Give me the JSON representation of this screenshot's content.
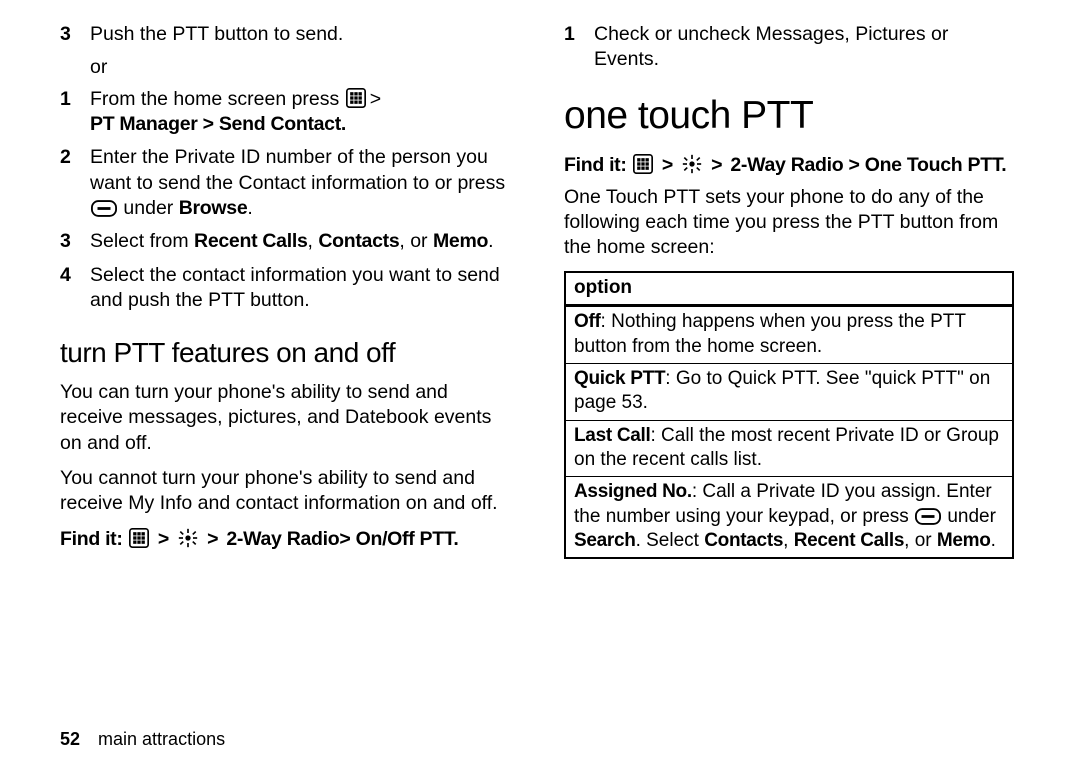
{
  "left": {
    "items": [
      {
        "n": "3",
        "text_a": "Push the PTT button to send."
      },
      {
        "or": "or"
      },
      {
        "n": "1",
        "text_a": "From the home screen press ",
        "after_icon": "",
        "path": "PT Manager > Send Contact."
      },
      {
        "n": "2",
        "text_a": "Enter the Private ID number of the person you want to send the Contact information to or press ",
        "after_soft": " under ",
        "browse": "Browse",
        "tail": "."
      },
      {
        "n": "3",
        "text_a": "Select from ",
        "b1": "Recent Calls",
        "sep1": ", ",
        "b2": "Contacts",
        "sep2": ", or ",
        "b3": "Memo",
        "tail": "."
      },
      {
        "n": "4",
        "text_a": "Select the contact information you want to send and push the PTT button."
      }
    ],
    "subhead": "turn PTT features on and off",
    "p1": "You can turn your phone's ability to send and receive messages, pictures, and Datebook events on and off.",
    "p2": "You cannot turn your phone's ability to send and receive My Info and contact information on and off.",
    "findit_label": "Find it:",
    "findit_path": " 2-Way Radio> On/Off PTT."
  },
  "right": {
    "item1": {
      "n": "1",
      "text": "Check or uncheck Messages, Pictures or Events."
    },
    "headline": "one touch PTT",
    "findit_label": "Find it:",
    "findit_path": " 2-Way Radio > One Touch PTT.",
    "intro": "One Touch PTT sets your phone to do any of the following each time you press the PTT button from the home screen:",
    "table": {
      "header": "option",
      "rows": [
        {
          "b": "Off",
          "text": ": Nothing happens when you press the PTT button from the home screen."
        },
        {
          "b": "Quick PTT",
          "text": ": Go to Quick PTT. See \"quick PTT\" on page 53."
        },
        {
          "b": "Last Call",
          "text": ": Call the most recent Private ID or Group on the recent calls list."
        },
        {
          "b": "Assigned No.",
          "text_a": ": Call a Private ID you assign. Enter the number using your keypad, or press ",
          "after_soft": " under ",
          "b1": "Search",
          "mid": ". Select ",
          "b2": "Contacts",
          "sep1": ", ",
          "b3": "Recent Calls",
          "sep2": ", or ",
          "b4": "Memo",
          "tail": "."
        }
      ]
    }
  },
  "footer": {
    "page": "52",
    "section": "main attractions"
  },
  "glyph_gt": ">"
}
